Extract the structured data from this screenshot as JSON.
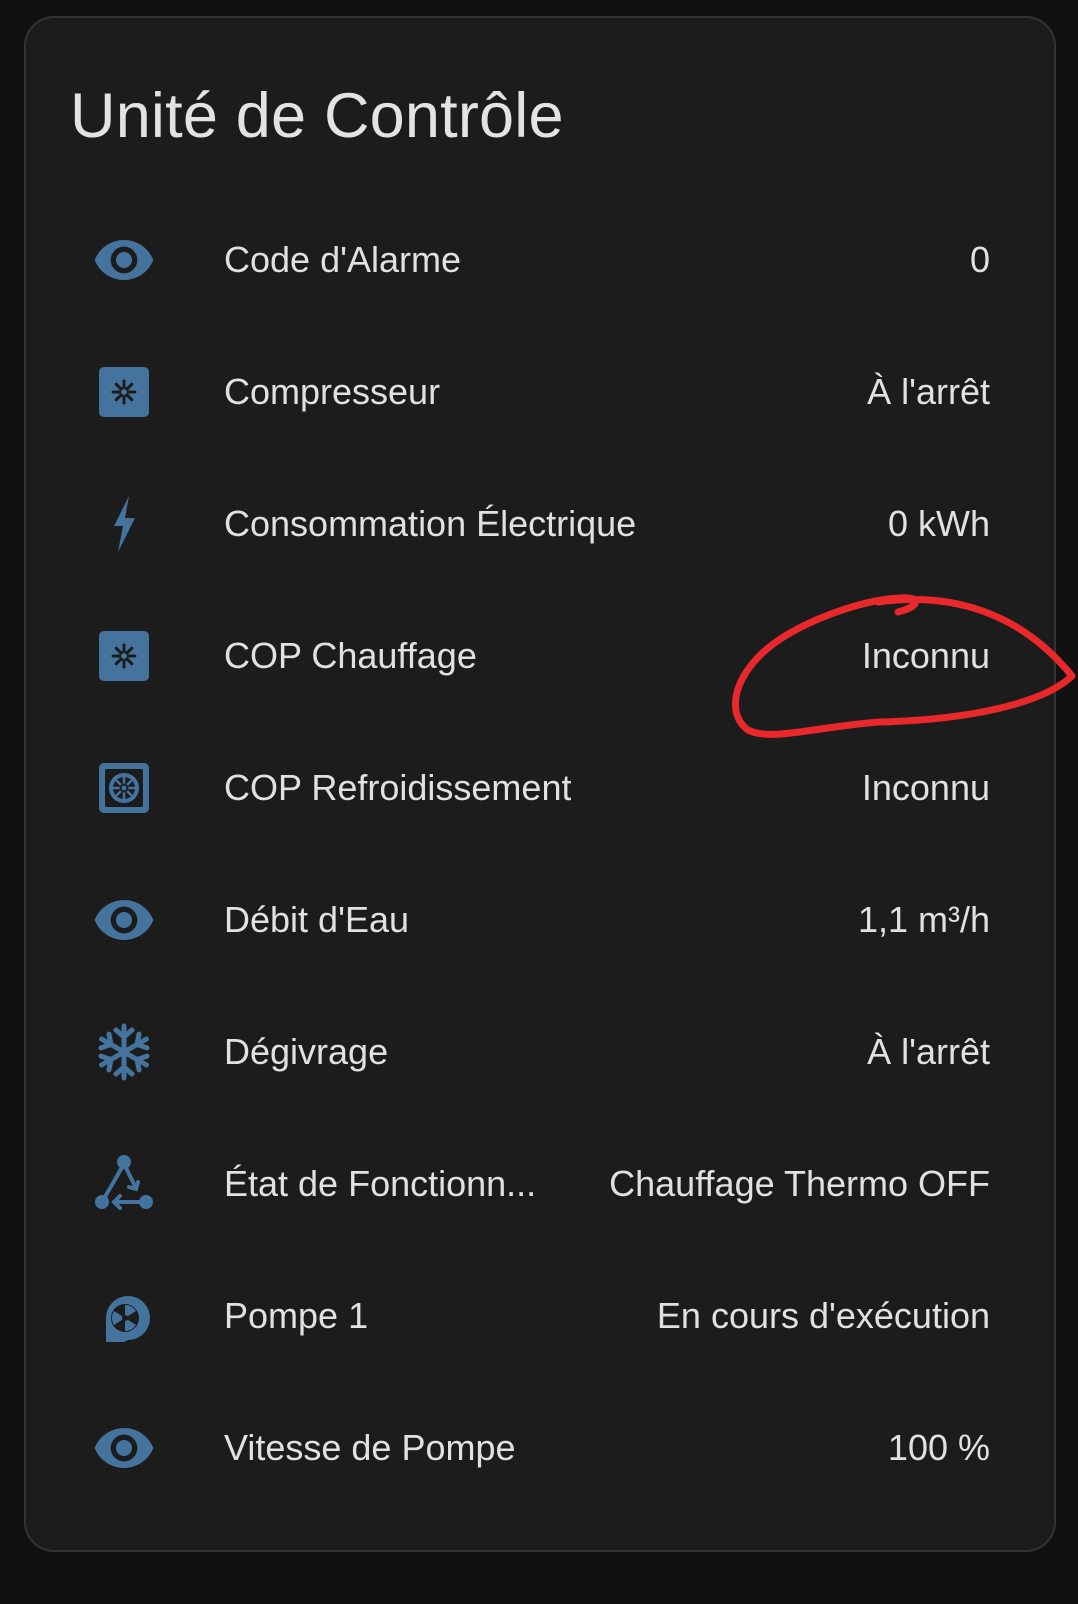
{
  "card": {
    "title": "Unité de Contrôle",
    "rows": [
      {
        "icon": "eye-icon",
        "label": "Code d'Alarme",
        "value": "0"
      },
      {
        "icon": "hvac-unit-icon",
        "label": "Compresseur",
        "value": "À l'arrêt"
      },
      {
        "icon": "lightning-bolt-icon",
        "label": "Consommation Électrique",
        "value": "0 kWh"
      },
      {
        "icon": "hvac-unit-icon",
        "label": "COP Chauffage",
        "value": "Inconnu"
      },
      {
        "icon": "hvac-unit-outline-icon",
        "label": "COP Refroidissement",
        "value": "Inconnu"
      },
      {
        "icon": "eye-icon",
        "label": "Débit d'Eau",
        "value": "1,1 m³/h"
      },
      {
        "icon": "snowflake-icon",
        "label": "Dégivrage",
        "value": "À l'arrêt"
      },
      {
        "icon": "state-machine-icon",
        "label": "État de Fonctionn...",
        "value": "Chauffage Thermo OFF"
      },
      {
        "icon": "pump-icon",
        "label": "Pompe 1",
        "value": "En cours d'exécution"
      },
      {
        "icon": "eye-icon",
        "label": "Vitesse de Pompe",
        "value": "100 %"
      }
    ]
  },
  "colors": {
    "icon": "#44739e",
    "annotation": "#e8282b",
    "card_background": "#1c1c1c",
    "page_background": "#111111",
    "text": "#e1e1e1"
  }
}
